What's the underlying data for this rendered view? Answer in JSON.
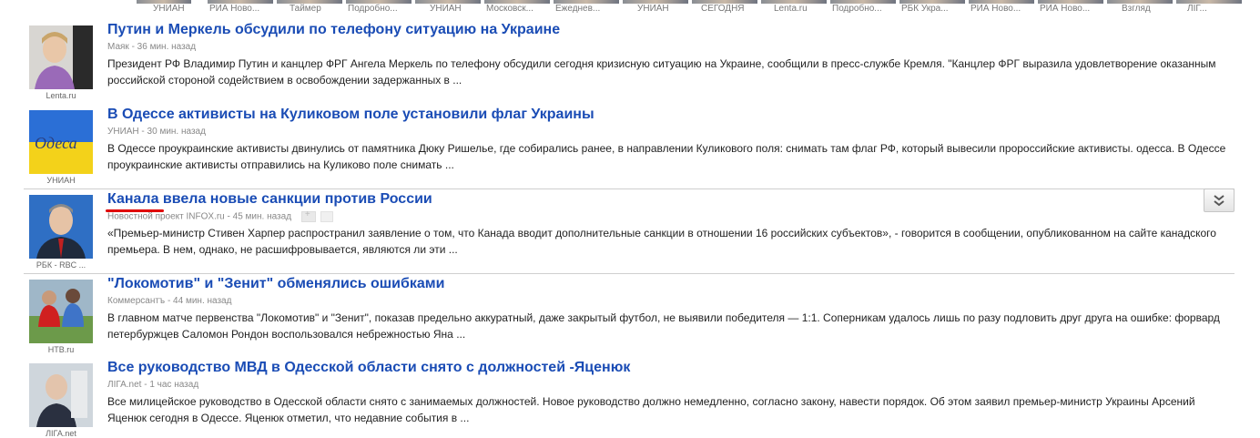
{
  "carousel": {
    "labels": [
      "УНИАН",
      "РИА Ново...",
      "Таймер",
      "Подробно...",
      "УНИАН",
      "Московск...",
      "Ежеднев...",
      "УНИАН",
      "СЕГОДНЯ",
      "Lenta.ru",
      "Подробно...",
      "РБК Укра...",
      "РИА Ново...",
      "РИА Ново...",
      "Взгляд",
      "ЛІГ..."
    ]
  },
  "news": [
    {
      "title": "Путин и Меркель обсудили по телефону ситуацию на Украине",
      "meta": "Маяк - 36 мин. назад",
      "snippet": "Президент РФ Владимир Путин и канцлер ФРГ Ангела Меркель по телефону обсудили сегодня кризисную ситуацию на Украине, сообщили в пресс-службе Кремля. \"Канцлер ФРГ выразила удовлетворение оказанным российской стороной содействием в освобождении задержанных в ...",
      "source": "Lenta.ru"
    },
    {
      "title": "В Одессе активисты на Куликовом поле установили флаг Украины",
      "meta": "УНИАН - 30 мин. назад",
      "snippet": "В Одессе проукраинские активисты двинулись от памятника Дюку Ришелье, где собирались ранее, в направлении Куликового поля: снимать там флаг РФ, который вывесили пророссийские активисты. одесса. В Одессе проукраинские активисты отправились на Куликово поле снимать ...",
      "source": "УНИАН"
    },
    {
      "title": "Канала ввела новые санкции против России",
      "meta": "Новостной проект INFOX.ru - 45 мин. назад",
      "snippet": "«Премьер-министр Стивен Харпер распространил заявление о том, что Канада вводит дополнительные санкции в отношении 16 российских субъектов», - говорится в сообщении, опубликованном на сайте канадского премьера. В нем, однако, не расшифровывается, являются ли эти ...",
      "source": "РБК - RBC ..."
    },
    {
      "title": "\"Локомотив\" и \"Зенит\" обменялись ошибками",
      "meta": "Коммерсантъ - 44 мин. назад",
      "snippet": "В главном матче первенства \"Локомотив\" и \"Зенит\", показав предельно аккуратный, даже закрытый футбол, не выявили победителя — 1:1. Соперникам удалось лишь по разу подловить друг друга на ошибке: форвард петербуржцев Саломон Рондон воспользовался небрежностью Яна ...",
      "source": "НТВ.ru"
    },
    {
      "title": "Все руководство МВД в Одесской области снято с должностей -Яценюк",
      "meta": "ЛIГА.net - 1 час назад",
      "snippet": "Все милицейское руководство в Одесской области снято с занимаемых должностей. Новое руководство должно немедленно, согласно закону, навести порядок. Об этом заявил премьер-министр Украины Арсений Яценюк сегодня в Одессе. Яценюк отметил, что недавние события в ...",
      "source": "ЛIГА.net"
    }
  ],
  "colors": {
    "title": "#1a4cb5",
    "annotation": "#e00000"
  },
  "icons": {
    "expand": "double-chevron-down-icon",
    "gplus": "google-plus-icon"
  }
}
